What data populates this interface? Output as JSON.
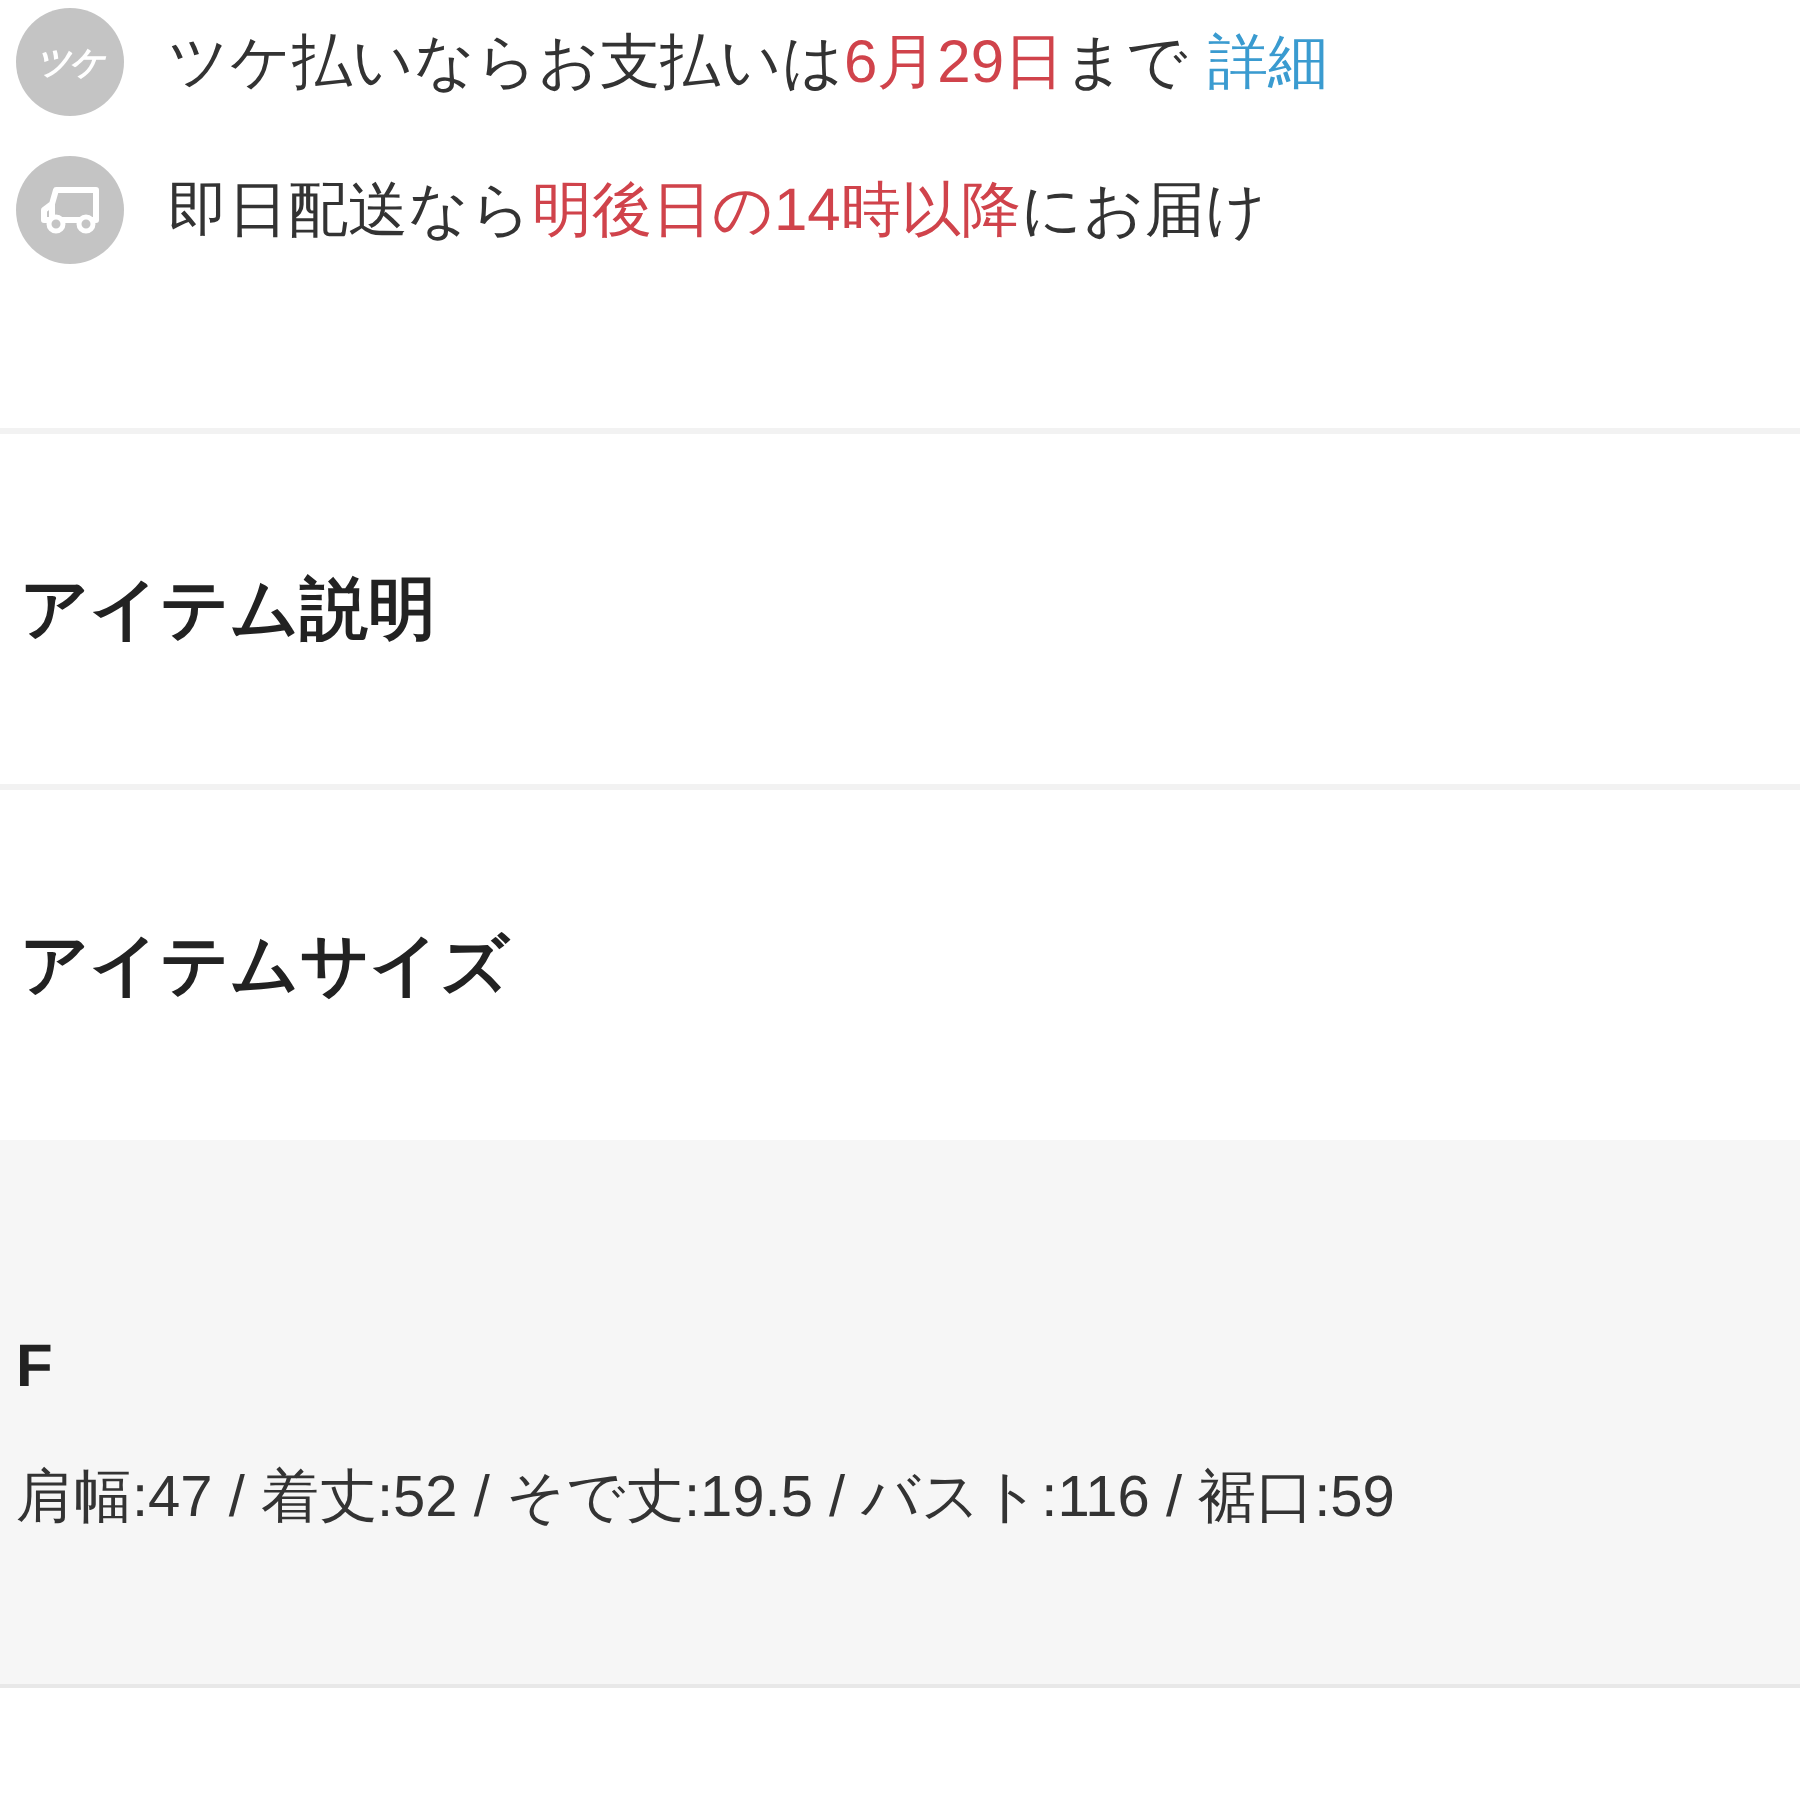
{
  "info_rows": [
    {
      "kind": "tsuke",
      "icon_text": "ツケ",
      "parts": [
        {
          "text": "ツケ払いならお支払いは",
          "highlight": false
        },
        {
          "text": "6月29日",
          "highlight": true
        },
        {
          "text": "まで",
          "highlight": false
        }
      ],
      "link": "詳細"
    },
    {
      "kind": "delivery",
      "parts": [
        {
          "text": "即日配送なら",
          "highlight": false
        },
        {
          "text": "明後日の14時以降",
          "highlight": true
        },
        {
          "text": "にお届け",
          "highlight": false
        }
      ]
    }
  ],
  "sections": [
    {
      "title": "アイテム説明"
    },
    {
      "title": "アイテムサイズ"
    }
  ],
  "size_panel": {
    "size": "F",
    "measurements": "肩幅:47 / 着丈:52 / そで丈:19.5 / バスト:116 / 裾口:59"
  }
}
